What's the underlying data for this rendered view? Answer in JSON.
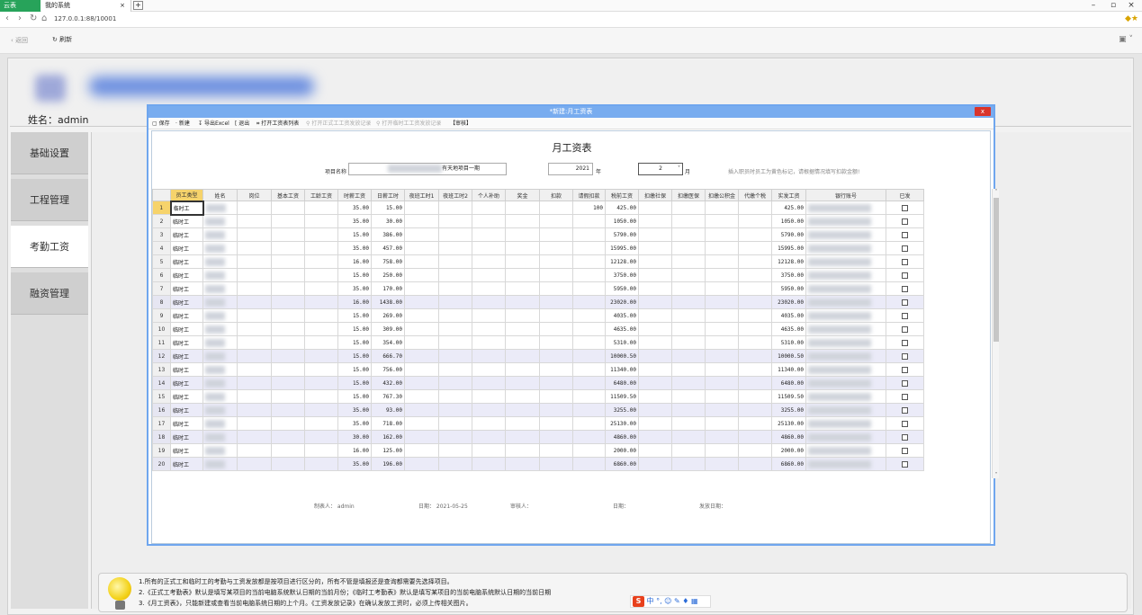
{
  "browser": {
    "tabs": [
      {
        "label": "云表"
      },
      {
        "label": "我的系统",
        "close": "×"
      }
    ],
    "new_tab": "+",
    "url": "127.0.0.1:88/10001",
    "win": {
      "min": "–",
      "max": "▫",
      "close": "×"
    }
  },
  "toolbar": {
    "back": "返回",
    "refresh": "刷新"
  },
  "header": {
    "username": "姓名：admin"
  },
  "sidebar": {
    "items": [
      {
        "label": "基础设置"
      },
      {
        "label": "工程管理"
      },
      {
        "label": "考勤工资"
      },
      {
        "label": "融资管理"
      }
    ]
  },
  "dialog": {
    "title": "*新建:月工资表",
    "close": "x",
    "toolbar": [
      {
        "label": "保存",
        "enabled": true
      },
      {
        "label": "新建",
        "enabled": true
      },
      {
        "label": "导出Excel",
        "enabled": true
      },
      {
        "label": "退出",
        "enabled": true
      },
      {
        "label": "打开工资表列表",
        "enabled": true
      },
      {
        "label": "打开正式工工资发放记录",
        "enabled": false
      },
      {
        "label": "打开临时工工资发放记录",
        "enabled": false
      },
      {
        "label": "【审核】",
        "enabled": true
      }
    ],
    "form": {
      "title": "月工资表",
      "project_label": "项目名称",
      "project_value": "有天地项目一期",
      "year_value": "2021",
      "year_label": "年",
      "month_value": "2",
      "month_label": "月",
      "note": "插入职员时员工为黄色标记，请根据情况填写扣款金额!"
    },
    "grid": {
      "columns": [
        "员工类型",
        "姓名",
        "岗位",
        "基本工资",
        "工龄工资",
        "时薪工资",
        "日薪工时",
        "夜班工时1",
        "夜班工时2",
        "个人补助",
        "奖金",
        "扣款",
        "请假扣款",
        "税前工资",
        "扣缴社保",
        "扣缴医保",
        "扣缴公积金",
        "代缴个税",
        "实发工资",
        "银行账号",
        "已发"
      ],
      "rows": [
        {
          "n": "1",
          "type": "临时工",
          "rate": "35.00",
          "hours": "15.00",
          "leave": "100",
          "pre": "425.00",
          "net": "425.00"
        },
        {
          "n": "2",
          "type": "临时工",
          "rate": "35.00",
          "hours": "30.00",
          "leave": "",
          "pre": "1050.00",
          "net": "1050.00"
        },
        {
          "n": "3",
          "type": "临时工",
          "rate": "15.00",
          "hours": "386.00",
          "leave": "",
          "pre": "5790.00",
          "net": "5790.00"
        },
        {
          "n": "4",
          "type": "临时工",
          "rate": "35.00",
          "hours": "457.00",
          "leave": "",
          "pre": "15995.00",
          "net": "15995.00"
        },
        {
          "n": "5",
          "type": "临时工",
          "rate": "16.00",
          "hours": "758.00",
          "leave": "",
          "pre": "12128.00",
          "net": "12128.00"
        },
        {
          "n": "6",
          "type": "临时工",
          "rate": "15.00",
          "hours": "250.00",
          "leave": "",
          "pre": "3750.00",
          "net": "3750.00"
        },
        {
          "n": "7",
          "type": "临时工",
          "rate": "35.00",
          "hours": "170.00",
          "leave": "",
          "pre": "5950.00",
          "net": "5950.00"
        },
        {
          "n": "8",
          "type": "临时工",
          "rate": "16.00",
          "hours": "1438.00",
          "leave": "",
          "pre": "23020.00",
          "net": "23020.00"
        },
        {
          "n": "9",
          "type": "临时工",
          "rate": "15.00",
          "hours": "269.00",
          "leave": "",
          "pre": "4035.00",
          "net": "4035.00"
        },
        {
          "n": "10",
          "type": "临时工",
          "rate": "15.00",
          "hours": "309.00",
          "leave": "",
          "pre": "4635.00",
          "net": "4635.00"
        },
        {
          "n": "11",
          "type": "临时工",
          "rate": "15.00",
          "hours": "354.00",
          "leave": "",
          "pre": "5310.00",
          "net": "5310.00"
        },
        {
          "n": "12",
          "type": "临时工",
          "rate": "15.00",
          "hours": "666.70",
          "leave": "",
          "pre": "10000.50",
          "net": "10000.50"
        },
        {
          "n": "13",
          "type": "临时工",
          "rate": "15.00",
          "hours": "756.00",
          "leave": "",
          "pre": "11340.00",
          "net": "11340.00"
        },
        {
          "n": "14",
          "type": "临时工",
          "rate": "15.00",
          "hours": "432.00",
          "leave": "",
          "pre": "6480.00",
          "net": "6480.00"
        },
        {
          "n": "15",
          "type": "临时工",
          "rate": "15.00",
          "hours": "767.30",
          "leave": "",
          "pre": "11509.50",
          "net": "11509.50"
        },
        {
          "n": "16",
          "type": "临时工",
          "rate": "35.00",
          "hours": "93.00",
          "leave": "",
          "pre": "3255.00",
          "net": "3255.00"
        },
        {
          "n": "17",
          "type": "临时工",
          "rate": "35.00",
          "hours": "718.00",
          "leave": "",
          "pre": "25130.00",
          "net": "25130.00"
        },
        {
          "n": "18",
          "type": "临时工",
          "rate": "30.00",
          "hours": "162.00",
          "leave": "",
          "pre": "4860.00",
          "net": "4860.00"
        },
        {
          "n": "19",
          "type": "临时工",
          "rate": "16.00",
          "hours": "125.00",
          "leave": "",
          "pre": "2000.00",
          "net": "2000.00"
        },
        {
          "n": "20",
          "type": "临时工",
          "rate": "35.00",
          "hours": "196.00",
          "leave": "",
          "pre": "6860.00",
          "net": "6860.00"
        }
      ]
    },
    "footer": {
      "maker": "制表人： admin",
      "date1": "日期： 2021-05-25",
      "auditor": "审核人：",
      "date2": "日期：",
      "paydate": "发放日期："
    }
  },
  "help": {
    "lines": [
      "1.所有的正式工和临时工的考勤与工资发放都是按项目进行区分的，所有不管是填报还是查询都需要先选择项目。",
      "2.《正式工考勤表》默认是填写某项目的当前电脑系统默认日期的当前月份；《临时工考勤表》默认是填写某项目的当前电脑系统默认日期的当前日期",
      "3.《月工资表》，只能新建或查看当前电脑系统日期的上个月。《工资发放记录》在确认发放工资时，必须上传相关图片。"
    ]
  },
  "ime": {
    "logo": "S",
    "text": "中 °, ☺ ✎ ♦ ▦"
  },
  "colors": {
    "accent": "#78acef",
    "active_menu": "#ffffff",
    "header_highlight": "#f6d36b",
    "row_highlight": "#ebebf8"
  }
}
